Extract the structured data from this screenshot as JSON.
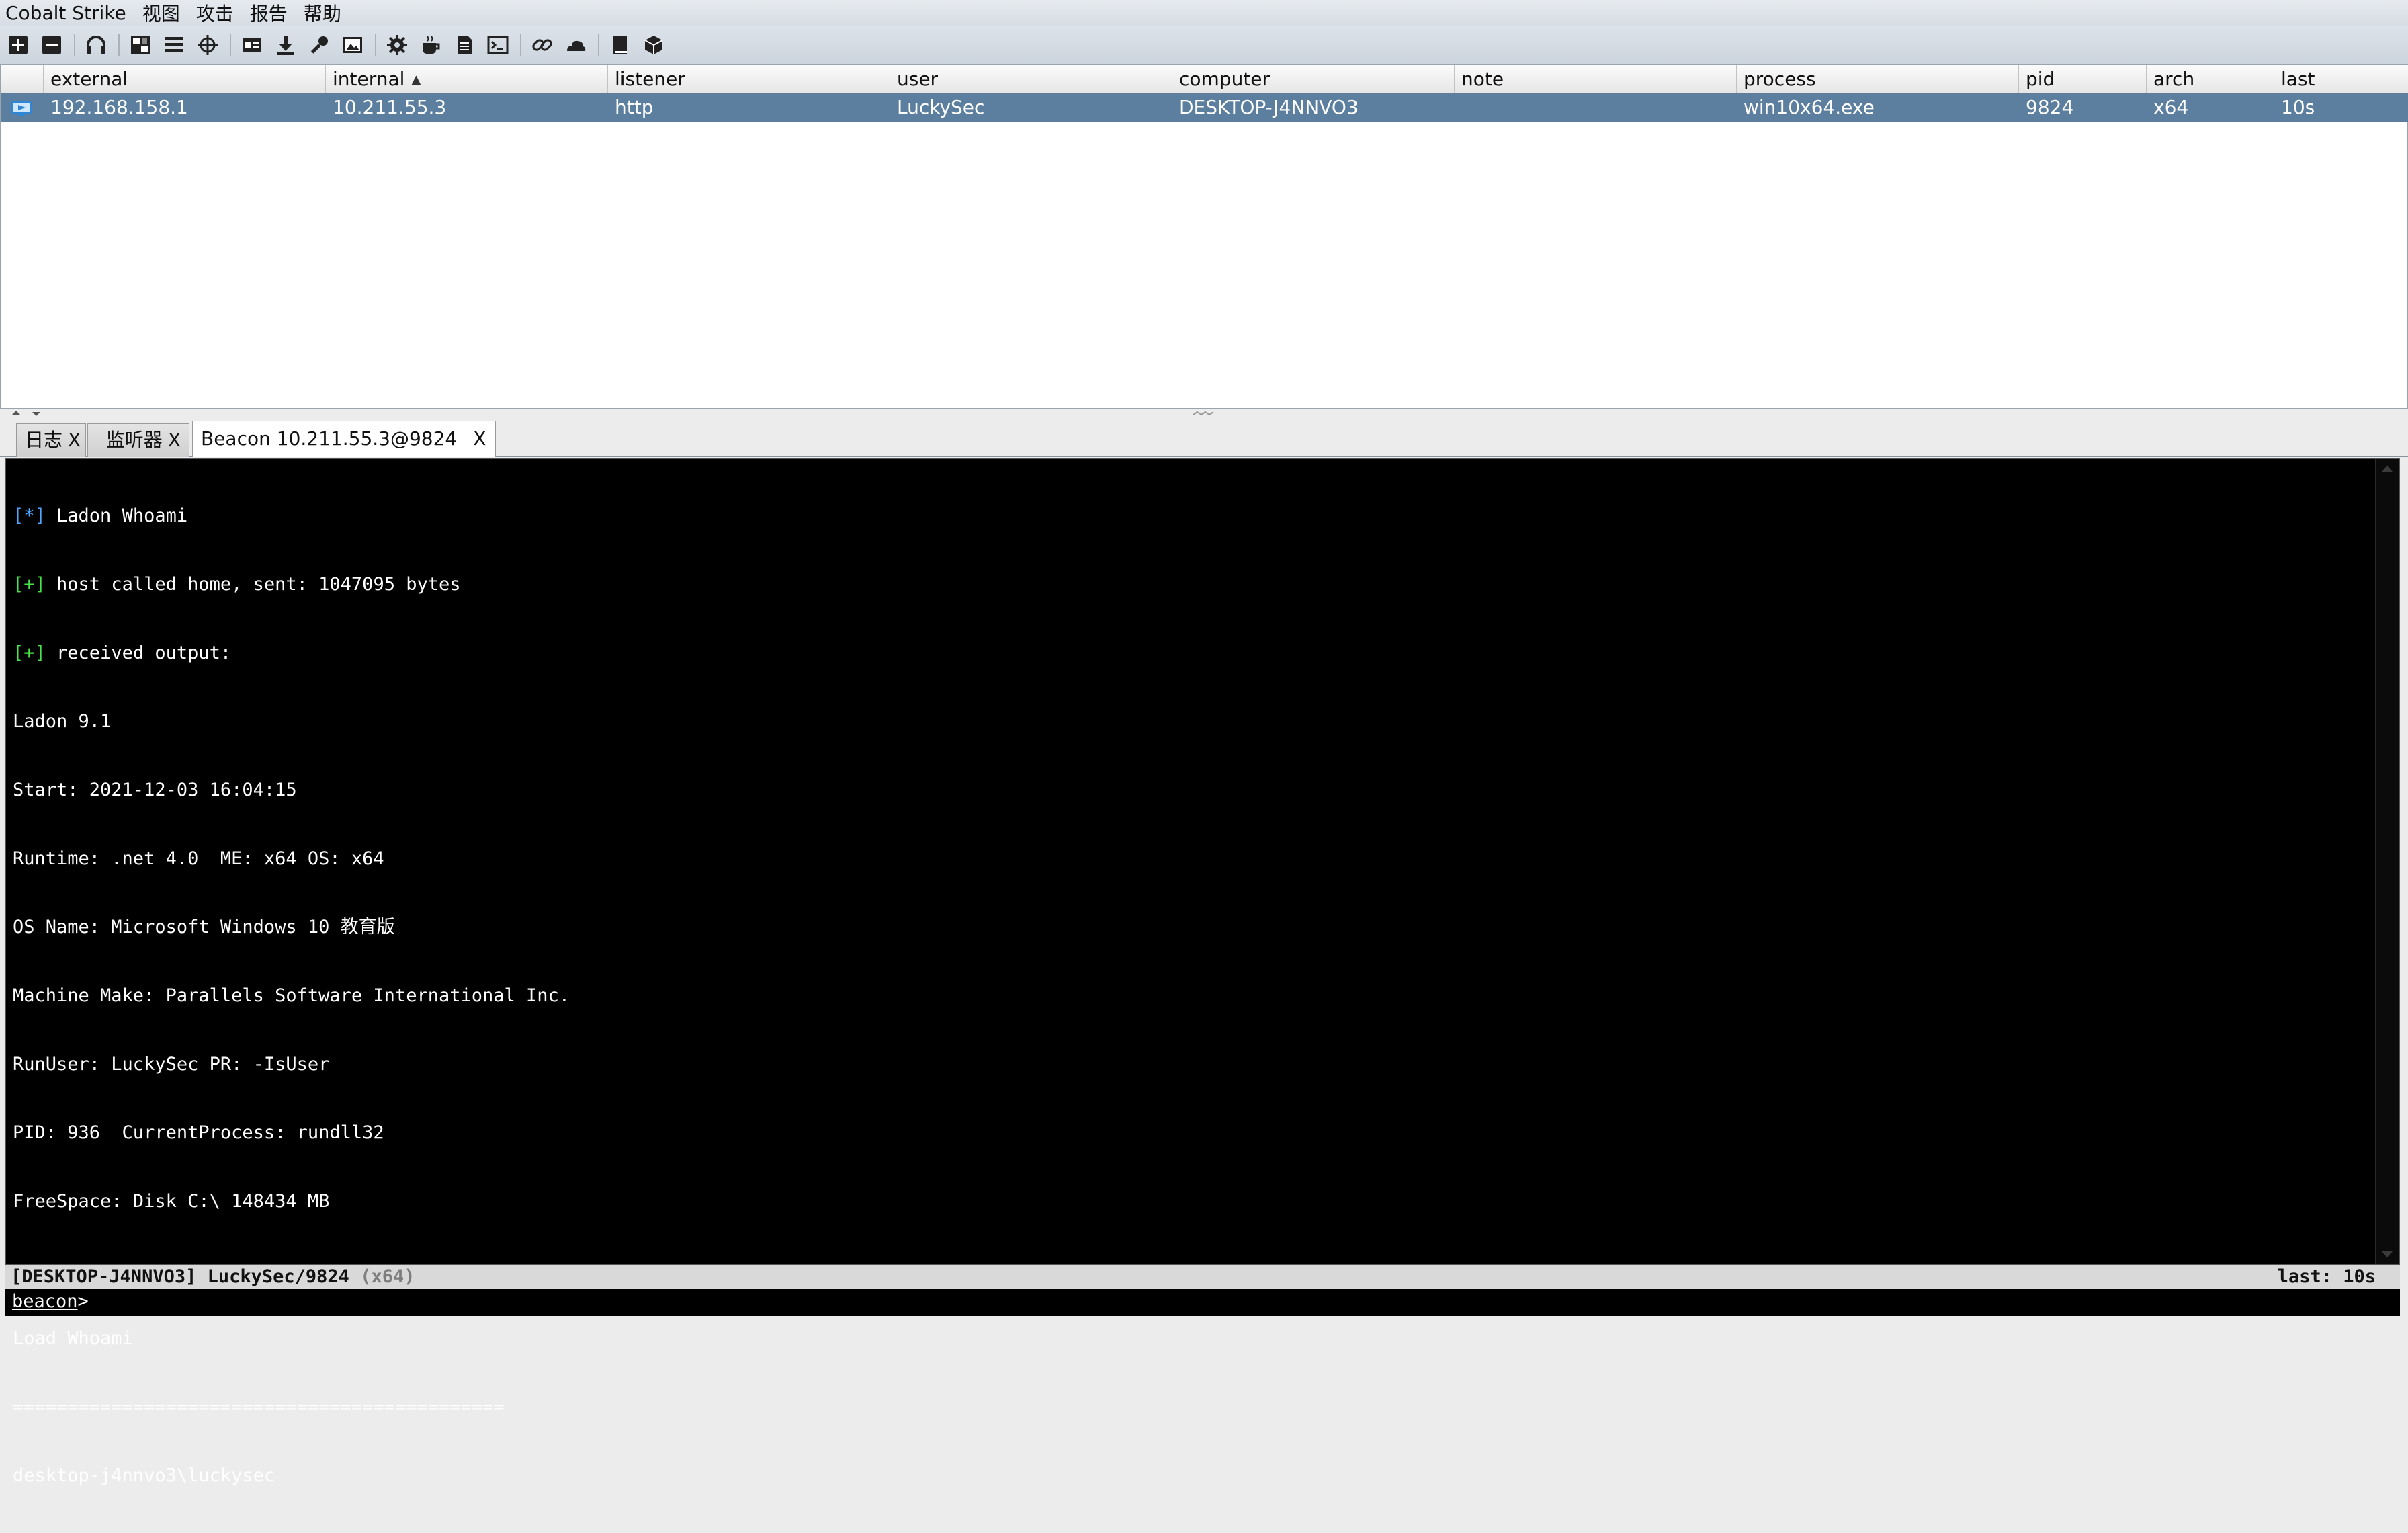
{
  "menu": [
    "Cobalt Strike",
    "视图",
    "攻击",
    "报告",
    "帮助"
  ],
  "toolbar_icons": [
    "new-connection-icon",
    "disconnect-icon",
    "headphones-icon",
    "pivot-graph-icon",
    "session-table-icon",
    "targets-icon",
    "credentials-icon",
    "downloads-icon",
    "keystrokes-icon",
    "screenshots-icon",
    "settings-icon",
    "coffee-icon",
    "script-console-icon",
    "terminal-icon",
    "link-icon",
    "cloud-icon",
    "manual-icon",
    "package-icon"
  ],
  "table": {
    "columns": [
      "external",
      "internal",
      "listener",
      "user",
      "computer",
      "note",
      "process",
      "pid",
      "arch",
      "last"
    ],
    "sort_indicator": "▲",
    "rows": [
      {
        "external": "192.168.158.1",
        "internal": "10.211.55.3",
        "listener": "http",
        "user": "LuckySec",
        "computer": "DESKTOP-J4NNVO3",
        "note": "",
        "process": "win10x64.exe",
        "pid": "9824",
        "arch": "x64",
        "last": "10s"
      }
    ],
    "selected_row_color": "#5c7f9f"
  },
  "tabs": [
    {
      "label": "日志",
      "close": "X"
    },
    {
      "label": "监听器",
      "close": "X"
    },
    {
      "label": "Beacon 10.211.55.3@9824",
      "close": "X",
      "active": true
    }
  ],
  "console": {
    "lines": [
      {
        "prefix": "[*]",
        "text": " Ladon Whoami",
        "color": "blue"
      },
      {
        "prefix": "[+]",
        "text": " host called home, sent: 1047095 bytes",
        "color": "green"
      },
      {
        "prefix": "[+]",
        "text": " received output:",
        "color": "green"
      },
      {
        "prefix": "",
        "text": "Ladon 9.1"
      },
      {
        "prefix": "",
        "text": "Start: 2021-12-03 16:04:15"
      },
      {
        "prefix": "",
        "text": "Runtime: .net 4.0  ME: x64 OS: x64"
      },
      {
        "prefix": "",
        "text": "OS Name: Microsoft Windows 10 教育版"
      },
      {
        "prefix": "",
        "text": "Machine Make: Parallels Software International Inc."
      },
      {
        "prefix": "",
        "text": "RunUser: LuckySec PR: -IsUser"
      },
      {
        "prefix": "",
        "text": "PID: 936  CurrentProcess: rundll32"
      },
      {
        "prefix": "",
        "text": "FreeSpace: Disk C:\\ 148434 MB"
      },
      {
        "prefix": "",
        "text": ""
      },
      {
        "prefix": "",
        "text": "Load Whoami"
      },
      {
        "prefix": "",
        "text": "============================================="
      },
      {
        "prefix": "",
        "text": "desktop-j4nnvo3\\luckysec"
      }
    ],
    "colors": {
      "blue": "#4da6ff",
      "green": "#47e447"
    }
  },
  "status": {
    "left": "[DESKTOP-J4NNVO3] LuckySec/9824",
    "arch": "(x64)",
    "right": "last: 10s"
  },
  "input": {
    "prompt": "beacon",
    "prompt_suffix": ">",
    "value": ""
  }
}
